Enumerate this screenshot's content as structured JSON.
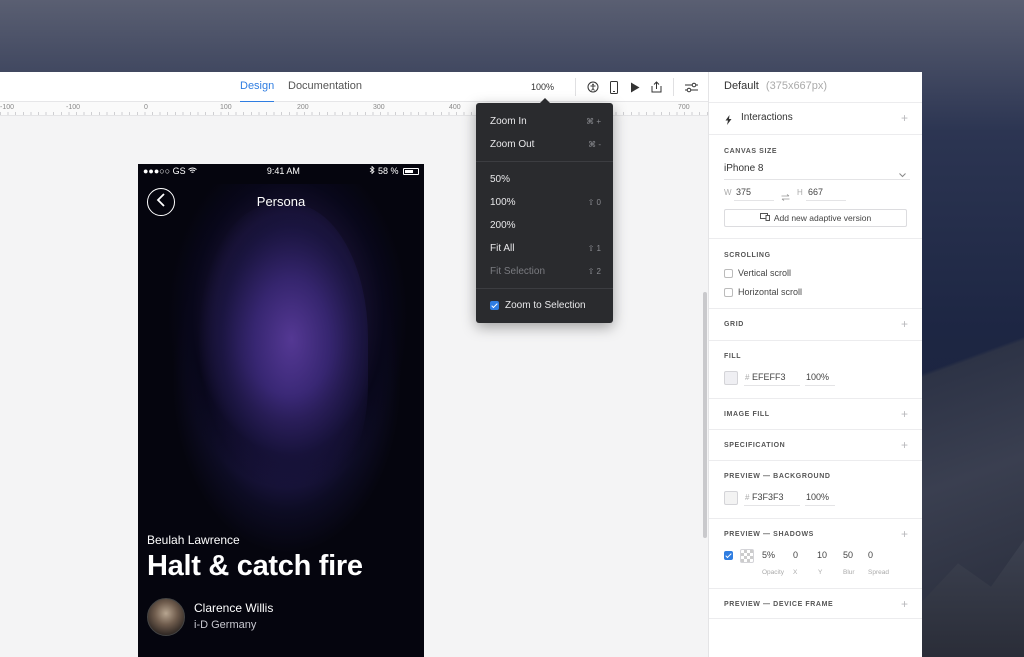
{
  "topbar": {
    "tabs": [
      {
        "label": "Design",
        "active": true
      },
      {
        "label": "Documentation",
        "active": false
      }
    ],
    "zoom": "100%",
    "icons": [
      "accessibility-icon",
      "device-preview-icon",
      "play-icon",
      "share-icon",
      "settings-sliders-icon"
    ]
  },
  "ruler": [
    "-100",
    "-100",
    "0",
    "100",
    "200",
    "300",
    "400",
    "700"
  ],
  "zoom_menu": {
    "items": [
      {
        "label": "Zoom In",
        "shortcut": "⌘ +"
      },
      {
        "label": "Zoom Out",
        "shortcut": "⌘ -"
      },
      {
        "label": "50%",
        "shortcut": ""
      },
      {
        "label": "100%",
        "shortcut": "⇧ 0"
      },
      {
        "label": "200%",
        "shortcut": ""
      },
      {
        "label": "Fit All",
        "shortcut": "⇧ 1"
      },
      {
        "label": "Fit Selection",
        "shortcut": "⇧ 2",
        "disabled": true
      },
      {
        "label": "Zoom to Selection",
        "checked": true
      }
    ]
  },
  "phone": {
    "status_left": "●●●○○ GS",
    "status_time": "9:41 AM",
    "status_battery": "58 %",
    "title": "Persona",
    "author": "Beulah Lawrence",
    "headline": "Halt & catch fire",
    "credit_name": "Clarence Willis",
    "credit_org": "i-D Germany"
  },
  "panel": {
    "artboard_name": "Default",
    "artboard_size": "(375x667px)",
    "interactions": "Interactions",
    "canvas_size": {
      "title": "CANVAS SIZE",
      "device": "iPhone 8",
      "w_label": "W",
      "w": "375",
      "h_label": "H",
      "h": "667",
      "adaptive_button": "Add new adaptive version"
    },
    "scrolling": {
      "title": "SCROLLING",
      "vertical": "Vertical scroll",
      "horizontal": "Horizontal scroll"
    },
    "grid": "GRID",
    "fill": {
      "title": "FILL",
      "hash": "#",
      "hex": "EFEFF3",
      "opacity": "100%",
      "color": "#EFEFF3"
    },
    "image_fill": "IMAGE FILL",
    "specification": "SPECIFICATION",
    "preview_bg": {
      "title": "PREVIEW — BACKGROUND",
      "hash": "#",
      "hex": "F3F3F3",
      "opacity": "100%",
      "color": "#F3F3F3"
    },
    "preview_shadows": {
      "title": "PREVIEW — SHADOWS",
      "opacity": "5%",
      "x": "0",
      "y": "10",
      "blur": "50",
      "spread": "0",
      "cap_opacity": "Opacity",
      "cap_x": "X",
      "cap_y": "Y",
      "cap_blur": "Blur",
      "cap_spread": "Spread"
    },
    "preview_frame": "PREVIEW — DEVICE FRAME"
  },
  "colors": {
    "accent": "#2f7de1",
    "menu_bg": "#2a2b2e"
  }
}
